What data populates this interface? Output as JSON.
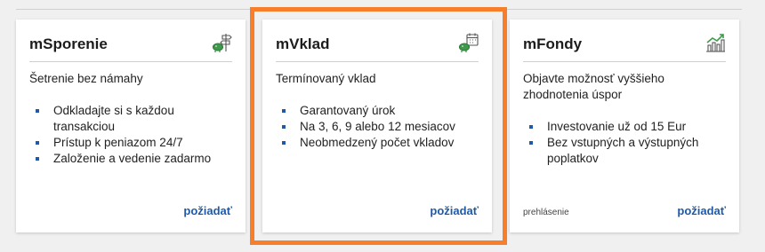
{
  "colors": {
    "accent": "#1f5aa8",
    "highlight": "#f77f2b",
    "icon_green": "#3f9a4a"
  },
  "cards": [
    {
      "title": "mSporenie",
      "icon": "piggy-bank-signpost-icon",
      "description": "Šetrenie bez námahy",
      "items": [
        "Odkladajte si s každou transakciou",
        "Prístup k peniazom 24/7",
        "Založenie a vedenie zadarmo"
      ],
      "link_label": "požiadať"
    },
    {
      "title": "mVklad",
      "icon": "piggy-bank-calendar-icon",
      "description": "Termínovaný vklad",
      "items": [
        "Garantovaný úrok",
        "Na 3, 6, 9 alebo 12 mesiacov",
        "Neobmedzený počet vkladov"
      ],
      "link_label": "požiadať",
      "highlighted": true
    },
    {
      "title": "mFondy",
      "icon": "bar-chart-growth-icon",
      "description": "Objavte možnosť vyššieho zhodnotenia úspor",
      "items": [
        "Investovanie už od 15 Eur",
        "Bez vstupných a výstupných poplatkov"
      ],
      "note": "prehlásenie",
      "link_label": "požiadať"
    }
  ]
}
